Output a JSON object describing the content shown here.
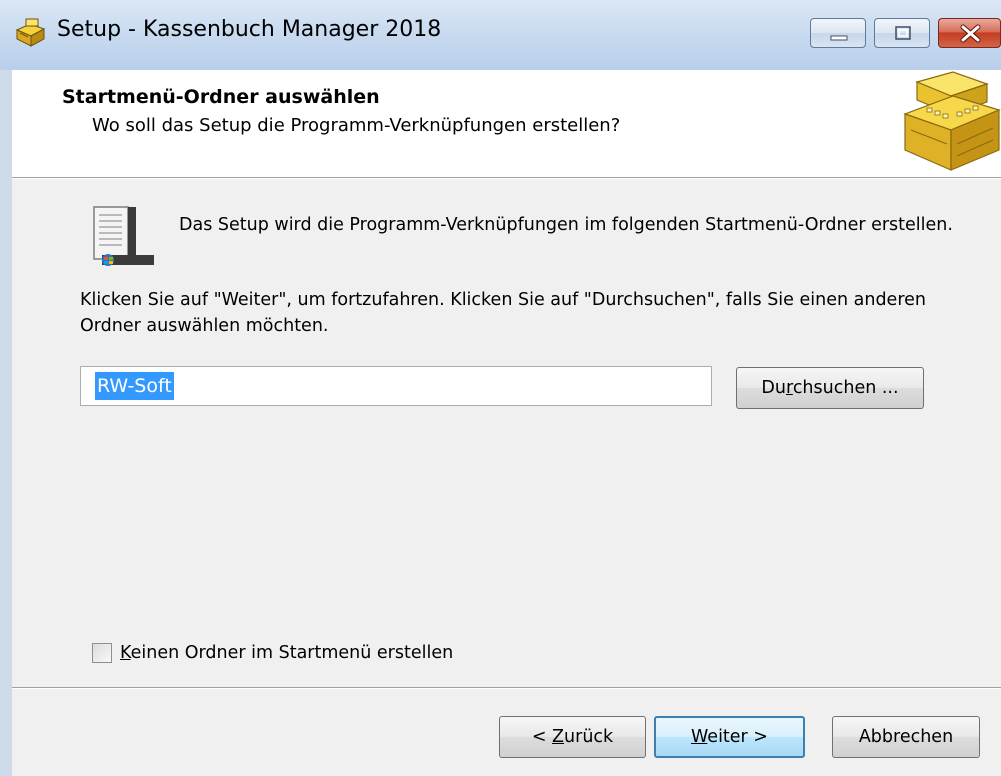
{
  "window": {
    "title": "Setup - Kassenbuch Manager 2018",
    "app_icon": "cash-register-icon",
    "caption_buttons": [
      "minimize",
      "maximize",
      "close"
    ]
  },
  "header": {
    "title": "Startmenü-Ordner auswählen",
    "subtitle": "Wo soll das Setup die Programm-Verknüpfungen erstellen?",
    "image": "cash-register-image"
  },
  "body": {
    "intro_text": "Das Setup wird die Programm-Verknüpfungen im folgenden Startmenü-Ordner erstellen.",
    "instructions": "Klicken Sie auf \"Weiter\", um fortzufahren. Klicken Sie auf \"Durchsuchen\", falls Sie einen anderen Ordner auswählen möchten.",
    "folder_value": "RW-Soft",
    "browse_label_pre": "Du",
    "browse_label_accel": "r",
    "browse_label_post": "chsuchen ...",
    "no_folder_checkbox": {
      "accel": "K",
      "label_rest": "einen Ordner im Startmenü erstellen",
      "checked": false
    }
  },
  "footer": {
    "back_pre": "< ",
    "back_accel": "Z",
    "back_post": "urück",
    "next_accel": "W",
    "next_post": "eiter >",
    "cancel_label": "Abbrechen"
  },
  "colors": {
    "selection": "#3399ff",
    "titlebar": "#c9dbf0",
    "close_button": "#c23e23",
    "default_button_border": "#3c7fb1"
  }
}
